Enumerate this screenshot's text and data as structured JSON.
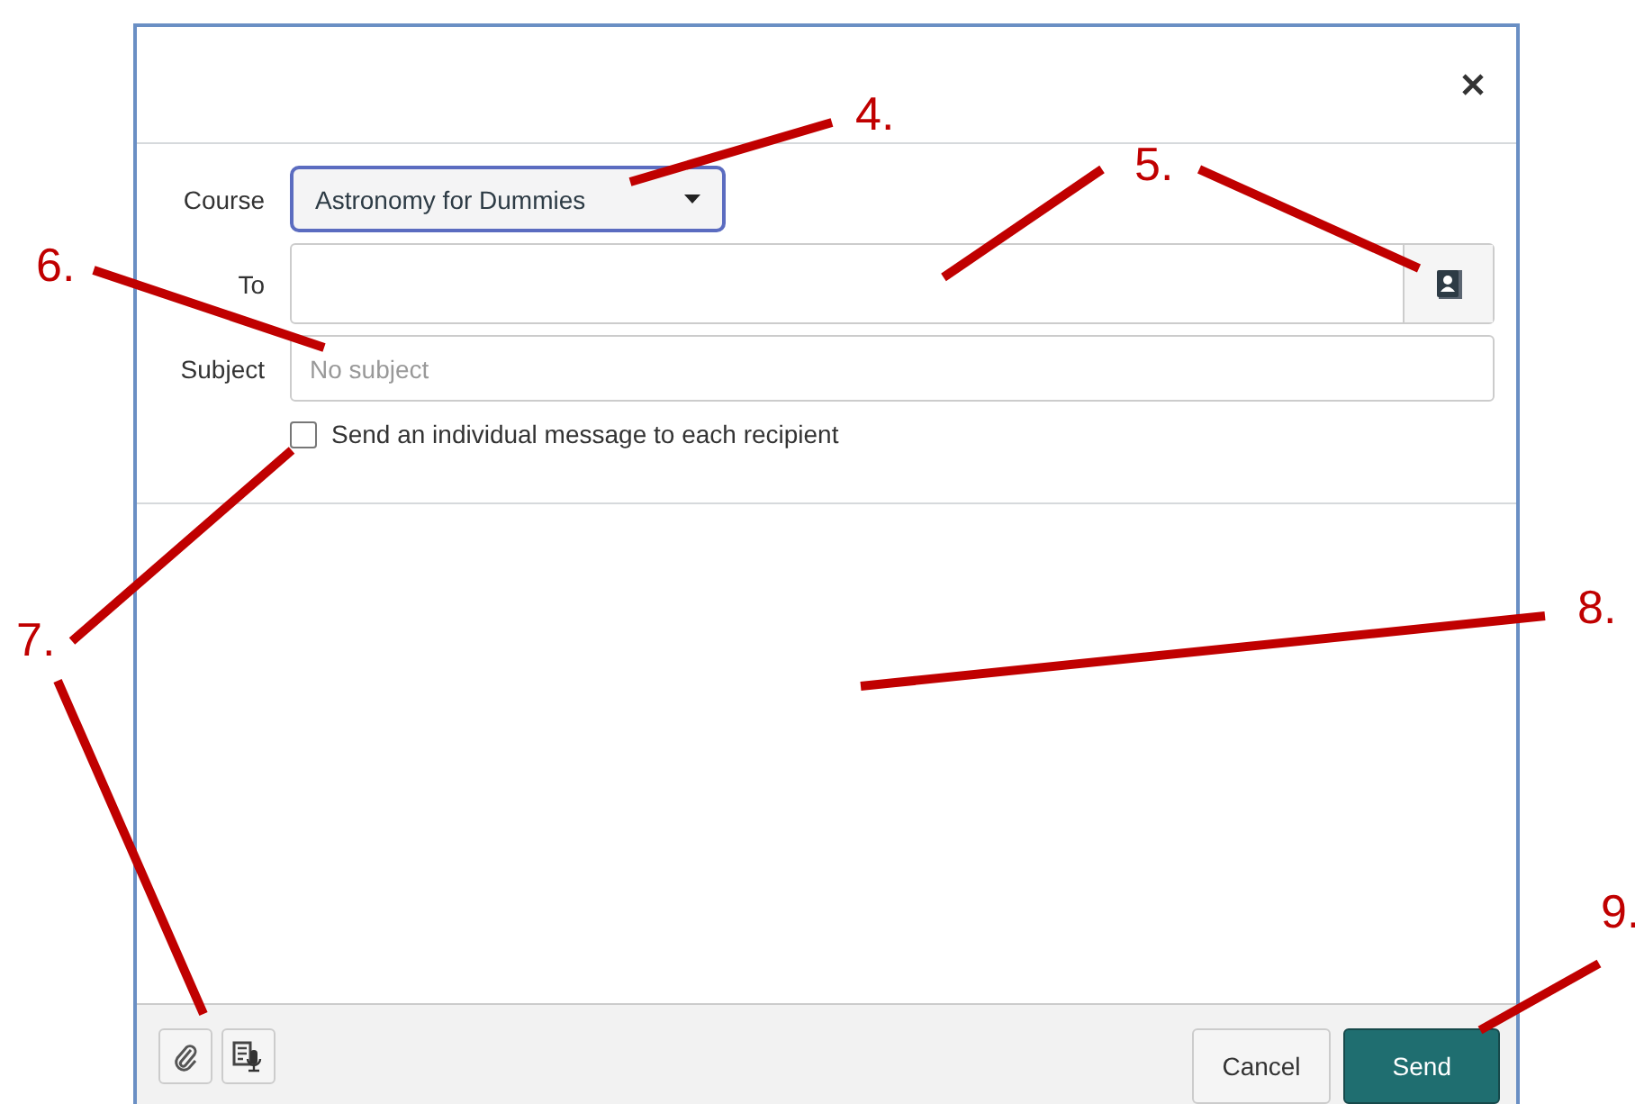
{
  "dialog": {
    "course": {
      "label": "Course",
      "value": "Astronomy for Dummies"
    },
    "to": {
      "label": "To"
    },
    "subject": {
      "label": "Subject",
      "placeholder": "No subject"
    },
    "individual": {
      "label": "Send an individual message to each recipient",
      "checked": false
    },
    "buttons": {
      "cancel": "Cancel",
      "send": "Send"
    }
  },
  "annotations": [
    {
      "label": "4."
    },
    {
      "label": "5."
    },
    {
      "label": "6."
    },
    {
      "label": "7."
    },
    {
      "label": "8."
    },
    {
      "label": "9."
    }
  ]
}
